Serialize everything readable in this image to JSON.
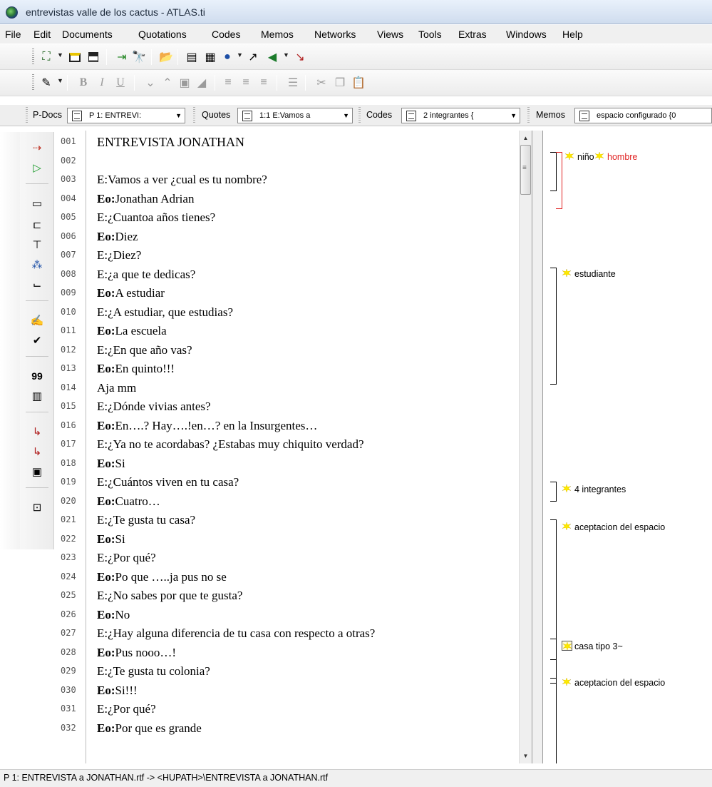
{
  "window": {
    "title": "entrevistas valle de los cactus - ATLAS.ti"
  },
  "menu": [
    "File",
    "Edit",
    "Documents",
    "Quotations",
    "Codes",
    "Memos",
    "Networks",
    "Views",
    "Tools",
    "Extras",
    "Windows",
    "Help"
  ],
  "toolbar2": {
    "bold": "B",
    "italic": "I",
    "underline": "U"
  },
  "selectors": {
    "pdocs": {
      "label": "P-Docs",
      "value": "P 1: ENTREVI:"
    },
    "quotes": {
      "label": "Quotes",
      "value": "1:1 E:Vamos a"
    },
    "codes": {
      "label": "Codes",
      "value": "2 integrantes {"
    },
    "memos": {
      "label": "Memos",
      "value": "espacio configurado {0"
    }
  },
  "left_toolbar": {
    "count_label": "99"
  },
  "document": {
    "lines": [
      {
        "n": "001",
        "speaker": "",
        "text": "ENTREVISTA JONATHAN"
      },
      {
        "n": "002",
        "speaker": "",
        "text": ""
      },
      {
        "n": "003",
        "speaker": "",
        "text": "E:Vamos a ver ¿cual es tu nombre?"
      },
      {
        "n": "004",
        "speaker": "Eo:",
        "text": "Jonathan Adrian"
      },
      {
        "n": "005",
        "speaker": "",
        "text": "E:¿Cuantoa años tienes?"
      },
      {
        "n": "006",
        "speaker": "Eo:",
        "text": "Diez"
      },
      {
        "n": "007",
        "speaker": "",
        "text": "E:¿Diez?"
      },
      {
        "n": "008",
        "speaker": "",
        "text": "E:¿a que te dedicas?"
      },
      {
        "n": "009",
        "speaker": "Eo:",
        "text": "A estudiar"
      },
      {
        "n": "010",
        "speaker": "",
        "text": "E:¿A estudiar, que estudias?"
      },
      {
        "n": "011",
        "speaker": "Eo:",
        "text": "La escuela"
      },
      {
        "n": "012",
        "speaker": "",
        "text": "E:¿En que año vas?"
      },
      {
        "n": "013",
        "speaker": "Eo:",
        "text": "En quinto!!!"
      },
      {
        "n": "014",
        "speaker": "",
        "text": "Aja mm"
      },
      {
        "n": "015",
        "speaker": "",
        "text": "E:¿Dónde vivias antes?"
      },
      {
        "n": "016",
        "speaker": "Eo:",
        "text": "En….? Hay….!en…? en la Insurgentes…"
      },
      {
        "n": "017",
        "speaker": "",
        "text": "E:¿Ya no te acordabas? ¿Estabas muy chiquito verdad?"
      },
      {
        "n": "018",
        "speaker": "Eo:",
        "text": "Si"
      },
      {
        "n": "019",
        "speaker": "",
        "text": "E:¿Cuántos viven en tu casa?"
      },
      {
        "n": "020",
        "speaker": "Eo:",
        "text": "Cuatro…"
      },
      {
        "n": "021",
        "speaker": "",
        "text": "E:¿Te gusta tu casa?"
      },
      {
        "n": "022",
        "speaker": "Eo:",
        "text": "Si"
      },
      {
        "n": "023",
        "speaker": "",
        "text": "E:¿Por qué?"
      },
      {
        "n": "024",
        "speaker": "Eo:",
        "text": "Po que …..ja pus no se"
      },
      {
        "n": "025",
        "speaker": "",
        "text": "E:¿No sabes por que te gusta?"
      },
      {
        "n": "026",
        "speaker": "Eo:",
        "text": "No"
      },
      {
        "n": "027",
        "speaker": "",
        "text": "E:¿Hay alguna diferencia de tu casa con respecto a otras?"
      },
      {
        "n": "028",
        "speaker": "Eo:",
        "text": "Pus nooo…!"
      },
      {
        "n": "029",
        "speaker": "",
        "text": "E:¿Te gusta tu colonia?"
      },
      {
        "n": "030",
        "speaker": "Eo:",
        "text": "Si!!!"
      },
      {
        "n": "031",
        "speaker": "",
        "text": "E:¿Por qué?"
      },
      {
        "n": "032",
        "speaker": "Eo:",
        "text": "Por que es grande"
      }
    ]
  },
  "margin_codes": [
    {
      "label": "niño",
      "color": "#000000"
    },
    {
      "label": "hombre",
      "color": "#e02020"
    },
    {
      "label": "estudiante",
      "color": "#000000"
    },
    {
      "label": "4 integrantes",
      "color": "#000000"
    },
    {
      "label": "aceptacion del espacio",
      "color": "#000000"
    },
    {
      "label": "casa tipo 3~",
      "color": "#000000"
    },
    {
      "label": "aceptacion del espacio",
      "color": "#000000"
    }
  ],
  "status": {
    "text": "P 1: ENTREVISTA a JONATHAN.rtf -> <HUPATH>\\ENTREVISTA a JONATHAN.rtf"
  }
}
